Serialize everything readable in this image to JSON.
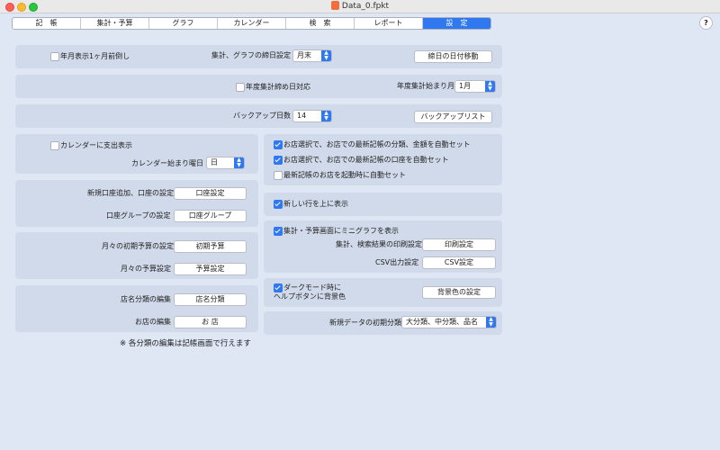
{
  "window": {
    "title": "Data_0.fpkt"
  },
  "tabs": [
    "記　帳",
    "集計・予算",
    "グラフ",
    "カレンダー",
    "検　索",
    "レポート",
    "設　定"
  ],
  "help_label": "?",
  "row1": {
    "prev_month_label": "年月表示1ヶ月前倒し",
    "closing_day_label": "集計、グラフの締日設定",
    "closing_day_value": "月末",
    "move_closing_button": "締日の日付移動"
  },
  "row2": {
    "fiscal_closing_label": "年度集計締め日対応",
    "fiscal_start_label": "年度集計始まり月",
    "fiscal_start_value": "1月"
  },
  "row3": {
    "backup_days_label": "バックアップ日数",
    "backup_days_value": "14",
    "backup_list_button": "バックアップリスト"
  },
  "calendar": {
    "show_expense_label": "カレンダーに支出表示",
    "week_start_label": "カレンダー始まり曜日",
    "week_start_value": "日"
  },
  "accounts": {
    "add_account_label": "新規口座追加、口座の設定",
    "account_button": "口座設定",
    "account_group_label": "口座グループの設定",
    "account_group_button": "口座グループ"
  },
  "budget": {
    "initial_budget_label": "月々の初期予算の設定",
    "initial_budget_button": "初期予算",
    "monthly_budget_label": "月々の予算設定",
    "monthly_budget_button": "予算設定"
  },
  "shops": {
    "shop_category_label": "店名分類の編集",
    "shop_category_button": "店名分類",
    "shop_edit_label": "お店の編集",
    "shop_edit_button": "お 店"
  },
  "footnote": "※ 各分類の編集は記帳画面で行えます",
  "auto_set": {
    "item1": "お店選択で、お店での最新記帳の分類、金額を自動セット",
    "item2": "お店選択で、お店での最新記帳の口座を自動セット",
    "item3": "最新記帳のお店を起動時に自動セット",
    "item1_checked": true,
    "item2_checked": true,
    "item3_checked": false
  },
  "new_row_top": {
    "label": "新しい行を上に表示",
    "checked": true
  },
  "mini_graph": {
    "label": "集計・予算画面にミニグラフを表示",
    "checked": true,
    "print_label": "集計、検索結果の印刷設定",
    "print_button": "印刷設定",
    "csv_label": "CSV出力設定",
    "csv_button": "CSV設定"
  },
  "dark_mode": {
    "label_line1": "ダークモード時に",
    "label_line2": "ヘルプボタンに背景色",
    "checked": true,
    "bg_button": "背景色の設定"
  },
  "new_data": {
    "label": "新規データの初期分類",
    "value": "大分類、中分類、品名"
  },
  "colors": {
    "accent": "#2f78f0",
    "background": "#dfe7f5",
    "panel": "#d1daea"
  }
}
